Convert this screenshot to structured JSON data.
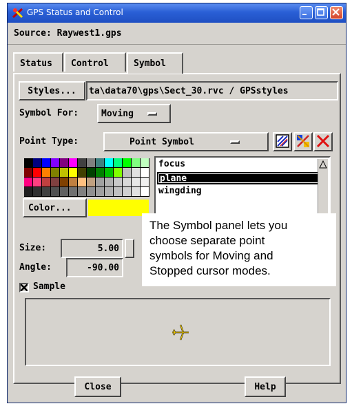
{
  "window": {
    "title": "GPS Status and Control",
    "source_label": "Source:",
    "source_value": "Raywest1.gps"
  },
  "tabs": [
    {
      "label": "Status",
      "active": false
    },
    {
      "label": "Control",
      "active": false
    },
    {
      "label": "Symbol",
      "active": true
    }
  ],
  "styles": {
    "button_label": "Styles...",
    "path_value": "ta\\data70\\gps\\Sect_30.rvc / GPSstyles"
  },
  "symbol_for": {
    "label": "Symbol For:",
    "value": "Moving"
  },
  "point_type": {
    "label": "Point Type:",
    "value": "Point Symbol"
  },
  "toolbar_icons": [
    "draw-symbol-icon",
    "multi-symbol-icon",
    "delete-x-icon"
  ],
  "palette_colors": [
    "#000000",
    "#000080",
    "#0000ff",
    "#8000ff",
    "#800080",
    "#ff00ff",
    "#404040",
    "#808080",
    "#408080",
    "#00ffff",
    "#00ff80",
    "#00ff00",
    "#80ff80",
    "#c0ffc0",
    "#800000",
    "#ff0000",
    "#ff8000",
    "#808000",
    "#c0c000",
    "#ffff00",
    "#404000",
    "#004000",
    "#008000",
    "#00c000",
    "#80ff00",
    "#c0c0c0",
    "#e0e0e0",
    "#ffffff",
    "#ff0080",
    "#ff4080",
    "#c04040",
    "#804040",
    "#804000",
    "#c08040",
    "#ffc080",
    "#c0a080",
    "#a0a0a0",
    "#b0b0b0",
    "#c8c8c8",
    "#d8d8d8",
    "#e8e8e8",
    "#f0f0f0",
    "#202020",
    "#303030",
    "#404040",
    "#505050",
    "#606060",
    "#707070",
    "#808080",
    "#909090",
    "#a0a0a0",
    "#b0b0b0",
    "#c0c0c0",
    "#d0d0d0",
    "#e0e0e0",
    "#ffffff"
  ],
  "color": {
    "button_label": "Color...",
    "swatch": "#ffff00"
  },
  "symbol_list": [
    {
      "label": "focus",
      "selected": false
    },
    {
      "label": "plane",
      "selected": true
    },
    {
      "label": "wingding",
      "selected": false
    }
  ],
  "size": {
    "label": "Size:",
    "value": "5.00"
  },
  "angle": {
    "label": "Angle:",
    "value": "-90.00"
  },
  "sample": {
    "label": "Sample",
    "checked": true,
    "symbol_color": "#f0c800"
  },
  "note": {
    "line1": "The Symbol panel lets you",
    "line2": "choose separate point",
    "line3": "symbols for Moving and",
    "line4": "Stopped cursor modes."
  },
  "buttons": {
    "close": "Close",
    "help": "Help"
  }
}
